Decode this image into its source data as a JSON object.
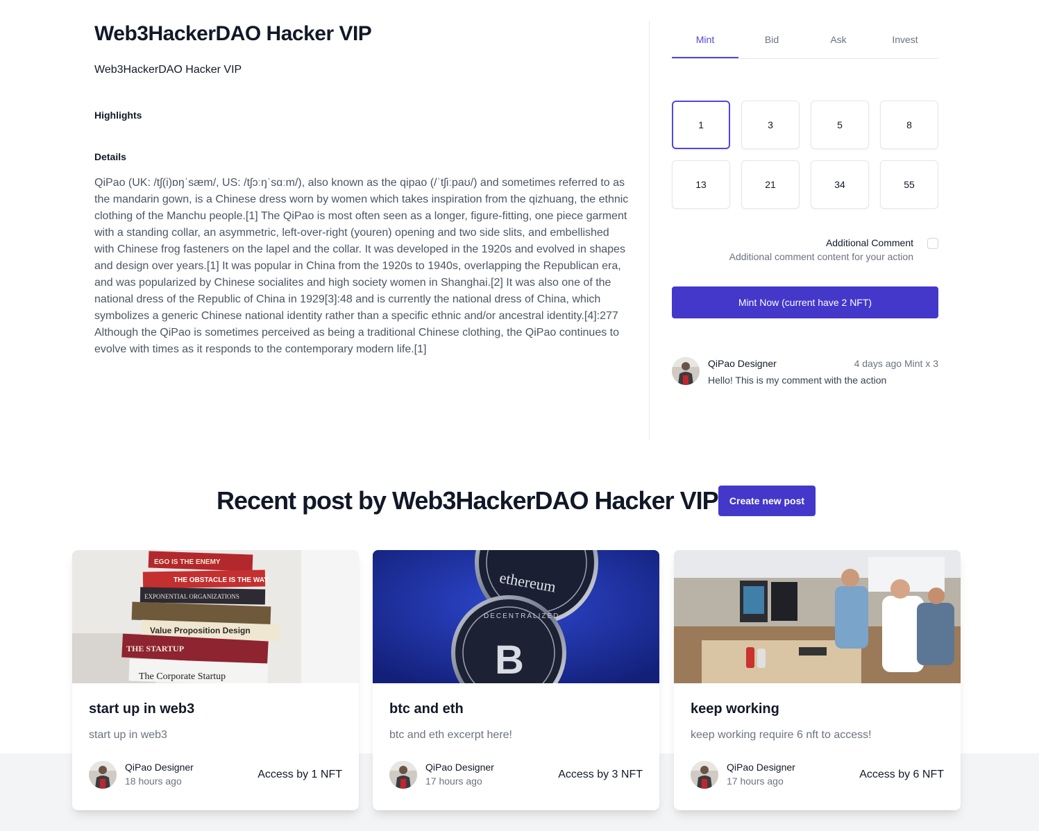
{
  "collection": {
    "title": "Web3HackerDAO Hacker VIP",
    "subtitle": "Web3HackerDAO Hacker VIP",
    "highlights_label": "Highlights",
    "details_label": "Details",
    "details_text": "QiPao (UK: /tʃ(i)ɒŋˈsæm/, US: /tʃɔːŋˈsɑːm/), also known as the qipao (/ˈtʃiːpaʊ/) and sometimes referred to as the mandarin gown, is a Chinese dress worn by women which takes inspiration from the qizhuang, the ethnic clothing of the Manchu people.[1] The QiPao is most often seen as a longer, figure-fitting, one piece garment with a standing collar, an asymmetric, left-over-right (youren) opening and two side slits, and embellished with Chinese frog fasteners on the lapel and the collar. It was developed in the 1920s and evolved in shapes and design over years.[1] It was popular in China from the 1920s to 1940s, overlapping the Republican era, and was popularized by Chinese socialites and high society women in Shanghai.[2] It was also one of the national dress of the Republic of China in 1929[3]:48 and is currently the national dress of China, which symbolizes a generic Chinese national identity rather than a specific ethnic and/or ancestral identity.[4]:277 Although the QiPao is sometimes perceived as being a traditional Chinese clothing, the QiPao continues to evolve with times as it responds to the contemporary modern life.[1]"
  },
  "action_panel": {
    "tabs": [
      {
        "label": "Mint",
        "active": true
      },
      {
        "label": "Bid",
        "active": false
      },
      {
        "label": "Ask",
        "active": false
      },
      {
        "label": "Invest",
        "active": false
      }
    ],
    "quantities": [
      "1",
      "3",
      "5",
      "8",
      "13",
      "21",
      "34",
      "55"
    ],
    "selected_quantity": "1",
    "additional_comment": {
      "label": "Additional Comment",
      "description": "Additional comment content for your action",
      "checked": false
    },
    "mint_button_label": "Mint Now (current have 2 NFT)",
    "activity": {
      "name": "QiPao Designer",
      "meta": "4 days ago Mint x 3",
      "text": "Hello! This is my comment with the action"
    }
  },
  "recent": {
    "title": "Recent post by Web3HackerDAO Hacker VIP",
    "create_button_label": "Create new post",
    "posts": [
      {
        "title": "start up in web3",
        "excerpt": "start up in web3",
        "author": "QiPao Designer",
        "time": "18 hours ago",
        "access": "Access by 1 NFT",
        "image": "stacked-books-photo"
      },
      {
        "title": "btc and eth",
        "excerpt": "btc and eth excerpt here!",
        "author": "QiPao Designer",
        "time": "17 hours ago",
        "access": "Access by 3 NFT",
        "image": "bitcoin-ethereum-coins-photo"
      },
      {
        "title": "keep working",
        "excerpt": "keep working require 6 nft to access!",
        "author": "QiPao Designer",
        "time": "17 hours ago",
        "access": "Access by 6 NFT",
        "image": "office-team-photo"
      }
    ]
  },
  "colors": {
    "accent": "#4f46e5",
    "button": "#4338ca",
    "text": "#111827",
    "muted": "#6b7280"
  }
}
